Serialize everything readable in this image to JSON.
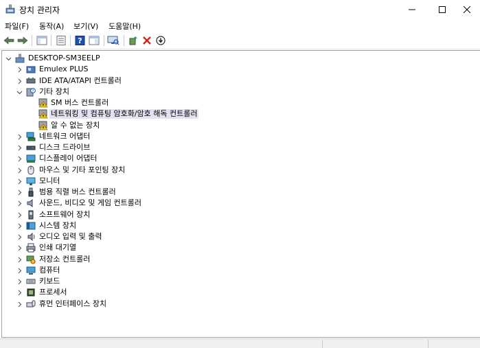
{
  "window": {
    "title": "장치 관리자",
    "app_icon": "device-manager-icon"
  },
  "window_controls": {
    "minimize": "—",
    "maximize": "☐",
    "close": "✕"
  },
  "menu": [
    "파일(F)",
    "동작(A)",
    "보기(V)",
    "도움말(H)"
  ],
  "toolbar": {
    "buttons": [
      "back-arrow-icon",
      "forward-arrow-icon",
      "show-hide-console-tree-icon",
      "properties-icon",
      "help-icon",
      "action-pane-icon",
      "scan-hardware-icon",
      "update-driver-icon",
      "uninstall-icon",
      "disable-device-icon"
    ]
  },
  "tree": {
    "root": "DESKTOP-SM3EELP",
    "nodes": [
      {
        "label": "Emulex PLUS",
        "icon": "emulex-icon",
        "state": "collapsed"
      },
      {
        "label": "IDE ATA/ATAPI 컨트롤러",
        "icon": "ide-controller-icon",
        "state": "collapsed"
      },
      {
        "label": "기타 장치",
        "icon": "other-devices-icon",
        "state": "expanded",
        "children": [
          {
            "label": "SM 버스 컨트롤러",
            "icon": "warning-device-icon"
          },
          {
            "label": "네트워킹 및 컴퓨팅 암호화/암호 해독 컨트롤러",
            "icon": "warning-device-icon",
            "selected": true
          },
          {
            "label": "알 수 없는 장치",
            "icon": "warning-device-icon"
          }
        ]
      },
      {
        "label": "네트워크 어댑터",
        "icon": "network-adapter-icon",
        "state": "collapsed"
      },
      {
        "label": "디스크 드라이브",
        "icon": "disk-drive-icon",
        "state": "collapsed"
      },
      {
        "label": "디스플레이 어댑터",
        "icon": "display-adapter-icon",
        "state": "collapsed"
      },
      {
        "label": "마우스 및 기타 포인팅 장치",
        "icon": "mouse-icon",
        "state": "collapsed"
      },
      {
        "label": "모니터",
        "icon": "monitor-icon",
        "state": "collapsed"
      },
      {
        "label": "범용 직렬 버스 컨트롤러",
        "icon": "usb-icon",
        "state": "collapsed"
      },
      {
        "label": "사운드, 비디오 및 게임 컨트롤러",
        "icon": "speaker-icon",
        "state": "collapsed"
      },
      {
        "label": "소프트웨어 장치",
        "icon": "software-device-icon",
        "state": "collapsed"
      },
      {
        "label": "시스템 장치",
        "icon": "system-device-icon",
        "state": "collapsed"
      },
      {
        "label": "오디오 입력 및 출력",
        "icon": "audio-io-icon",
        "state": "collapsed"
      },
      {
        "label": "인쇄 대기열",
        "icon": "printer-icon",
        "state": "collapsed"
      },
      {
        "label": "저장소 컨트롤러",
        "icon": "storage-controller-icon",
        "state": "collapsed"
      },
      {
        "label": "컴퓨터",
        "icon": "computer-icon",
        "state": "collapsed"
      },
      {
        "label": "키보드",
        "icon": "keyboard-icon",
        "state": "collapsed"
      },
      {
        "label": "프로세서",
        "icon": "processor-icon",
        "state": "collapsed"
      },
      {
        "label": "휴먼 인터페이스 장치",
        "icon": "hid-icon",
        "state": "collapsed"
      }
    ]
  },
  "colors": {
    "selection": "#e5e1f3",
    "border": "#a0a0a0",
    "uninstall_red": "#d2281e",
    "help_blue": "#1f4fb5"
  }
}
